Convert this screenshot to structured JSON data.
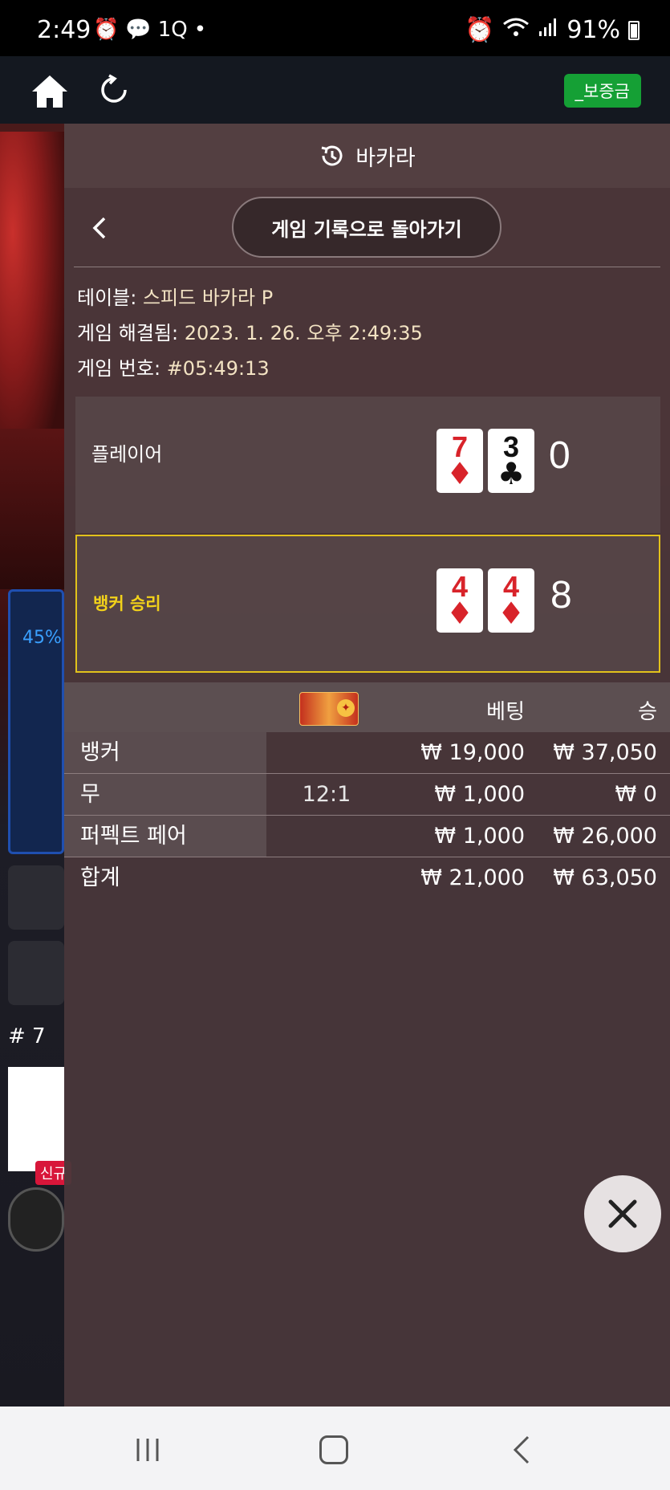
{
  "status_bar": {
    "time": "2:49",
    "left_icons": [
      "alarm-icon",
      "chat-icon",
      "1Q",
      "•"
    ],
    "battery": "91%"
  },
  "app_bar": {
    "deposit_label": "_보증금"
  },
  "background": {
    "percent": "45%",
    "round": "# 7",
    "new_badge": "신규"
  },
  "panel": {
    "title": "바카라",
    "back_to_history": "게임 기록으로 돌아가기",
    "table_label": "테이블:",
    "table_value": "스피드 바카라 P",
    "resolved_label": "게임 해결됨:",
    "resolved_value": "2023. 1. 26. 오후 2:49:35",
    "game_no_label": "게임 번호:",
    "game_no_value": "#05:49:13"
  },
  "hands": {
    "player": {
      "label": "플레이어",
      "cards": [
        {
          "rank": "7",
          "suit": "♦",
          "color": "red"
        },
        {
          "rank": "3",
          "suit": "♣",
          "color": "black"
        }
      ],
      "score": "0"
    },
    "banker": {
      "label": "뱅커 승리",
      "cards": [
        {
          "rank": "4",
          "suit": "♦",
          "color": "red"
        },
        {
          "rank": "4",
          "suit": "♦",
          "color": "red"
        }
      ],
      "score": "8"
    }
  },
  "bets": {
    "header_bet": "베팅",
    "header_win": "승",
    "rows": [
      {
        "name": "뱅커",
        "odds": "",
        "bet": "₩ 19,000",
        "win": "₩ 37,050"
      },
      {
        "name": "무",
        "odds": "12:1",
        "bet": "₩ 1,000",
        "win": "₩ 0"
      },
      {
        "name": "퍼펙트 페어",
        "odds": "",
        "bet": "₩ 1,000",
        "win": "₩ 26,000"
      }
    ],
    "total": {
      "name": "합계",
      "bet": "₩ 21,000",
      "win": "₩ 63,050"
    }
  },
  "colors": {
    "winner_border": "#e2c21b",
    "deposit_button": "#15a035",
    "card_red": "#d8232a"
  }
}
